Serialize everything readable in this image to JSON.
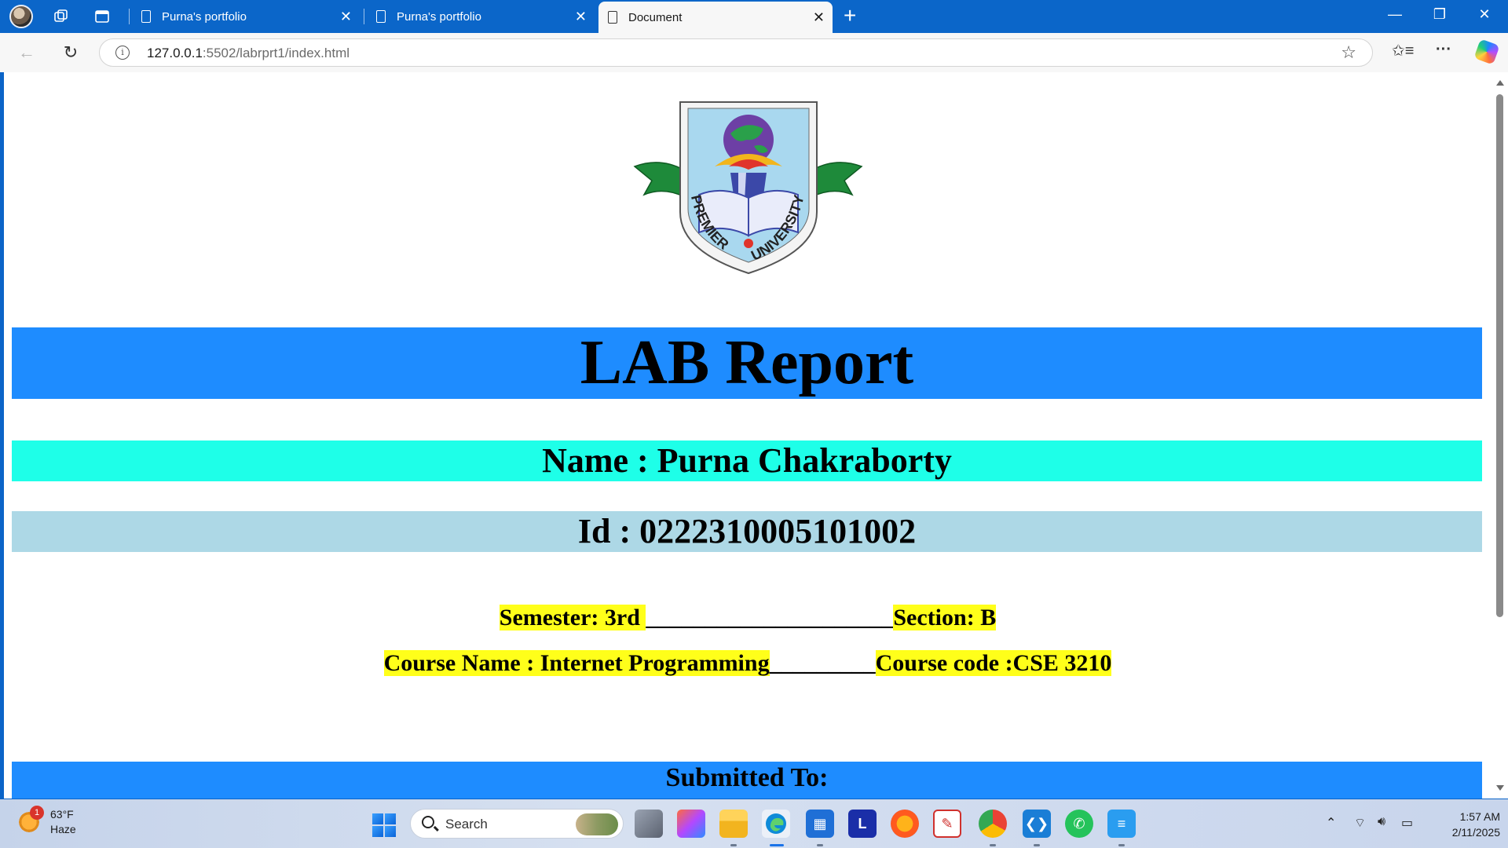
{
  "browser": {
    "tabs": [
      {
        "title": "Purna's portfolio",
        "active": false
      },
      {
        "title": "Purna's portfolio",
        "active": false
      },
      {
        "title": "Document",
        "active": true
      }
    ],
    "url": {
      "host": "127.0.0.1",
      "path": ":5502/labrprt1/index.html"
    },
    "accent": "#0b66c9"
  },
  "page": {
    "logo": {
      "arc_text_left": "PREMIER",
      "arc_text_right": "UNIVERSITY"
    },
    "title": "LAB Report",
    "name_line": "Name : Purna Chakraborty",
    "id_line": "Id : 0222310005101002",
    "semester": "Semester: 3rd ",
    "separator1": "_____________________",
    "section": "Section: B",
    "course_name": "Course Name : Internet Programming",
    "separator2": "_________",
    "course_code": "Course code :CSE 3210",
    "submitted_to": "Submitted To:",
    "colors": {
      "title_band": "#1e8cff",
      "name_band": "#1effe8",
      "id_band": "#add8e6",
      "highlight": "#ffff1a"
    }
  },
  "taskbar": {
    "weather": {
      "temp": "63°F",
      "condition": "Haze",
      "badge": "1"
    },
    "search_label": "Search",
    "clock": {
      "time": "1:57 AM",
      "date": "2/11/2025"
    },
    "apps": [
      "task-view",
      "file-explorer",
      "copilot-app",
      "edge",
      "microsoft-store",
      "l-app",
      "firefox",
      "pdf-reader",
      "chrome",
      "vscode",
      "whatsapp",
      "notepad"
    ]
  }
}
